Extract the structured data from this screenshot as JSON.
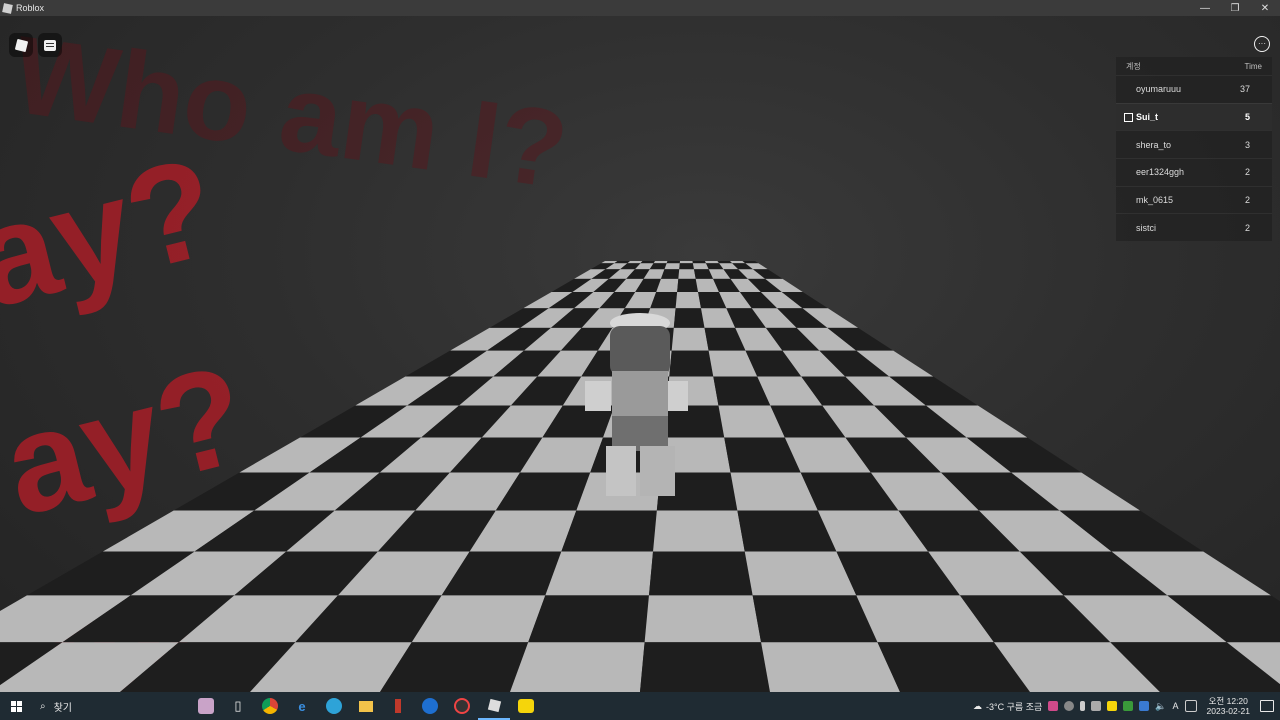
{
  "window": {
    "title": "Roblox",
    "minimize_glyph": "—",
    "restore_glyph": "❐",
    "close_glyph": "✕"
  },
  "scene": {
    "texts": [
      "Who am I?",
      "ay?",
      "ay?",
      "ay"
    ],
    "text_color": "#b0202a",
    "floor_light": "#b8b8b8",
    "floor_dark": "#1e1e1e"
  },
  "hud": {
    "roblox_menu_icon": "roblox-logo-icon",
    "chat_icon": "chat-icon",
    "more_icon": "more-options-icon"
  },
  "leaderboard": {
    "header_left": "계정",
    "header_right": "Time",
    "rows": [
      {
        "name": "oyumaruuu",
        "time": "37"
      },
      {
        "name": "Sui_t",
        "time": "5"
      },
      {
        "name": "shera_to",
        "time": "3"
      },
      {
        "name": "eer1324ggh",
        "time": "2"
      },
      {
        "name": "mk_0615",
        "time": "2"
      },
      {
        "name": "sistci",
        "time": "2"
      }
    ]
  },
  "taskbar": {
    "search_label": "찾기",
    "weather": "-3°C 구름 조금",
    "time": "오전 12:20",
    "date": "2023-02-21",
    "ime": "A",
    "accent": "#6cb8ff"
  }
}
